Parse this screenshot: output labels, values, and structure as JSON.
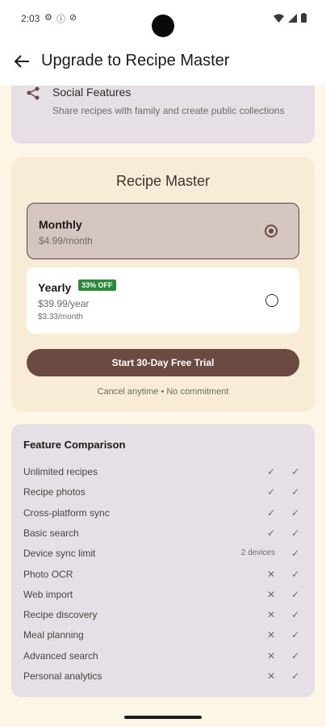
{
  "status_bar": {
    "time": "2:03"
  },
  "app_bar": {
    "title": "Upgrade to Recipe Master"
  },
  "social": {
    "title": "Social Features",
    "description": "Share recipes with family and create public collections"
  },
  "plan": {
    "title": "Recipe Master",
    "monthly": {
      "name": "Monthly",
      "price": "$4.99/month",
      "selected": true
    },
    "yearly": {
      "name": "Yearly",
      "badge": "33% OFF",
      "price": "$39.99/year",
      "per_month": "$3.33/month",
      "selected": false
    },
    "cta_label": "Start 30-Day Free Trial",
    "cancel_note": "Cancel anytime • No commitment"
  },
  "comparison": {
    "title": "Feature Comparison",
    "rows": [
      {
        "feature": "Unlimited recipes",
        "free": "✓",
        "pro": "✓"
      },
      {
        "feature": "Recipe photos",
        "free": "✓",
        "pro": "✓"
      },
      {
        "feature": "Cross-platform sync",
        "free": "✓",
        "pro": "✓"
      },
      {
        "feature": "Basic search",
        "free": "✓",
        "pro": "✓"
      },
      {
        "feature": "Device sync limit",
        "free": "2 devices",
        "pro": "✓"
      },
      {
        "feature": "Photo OCR",
        "free": "✕",
        "pro": "✓"
      },
      {
        "feature": "Web import",
        "free": "✕",
        "pro": "✓"
      },
      {
        "feature": "Recipe discovery",
        "free": "✕",
        "pro": "✓"
      },
      {
        "feature": "Meal planning",
        "free": "✕",
        "pro": "✓"
      },
      {
        "feature": "Advanced search",
        "free": "✕",
        "pro": "✓"
      },
      {
        "feature": "Personal analytics",
        "free": "✕",
        "pro": "✓"
      }
    ]
  }
}
